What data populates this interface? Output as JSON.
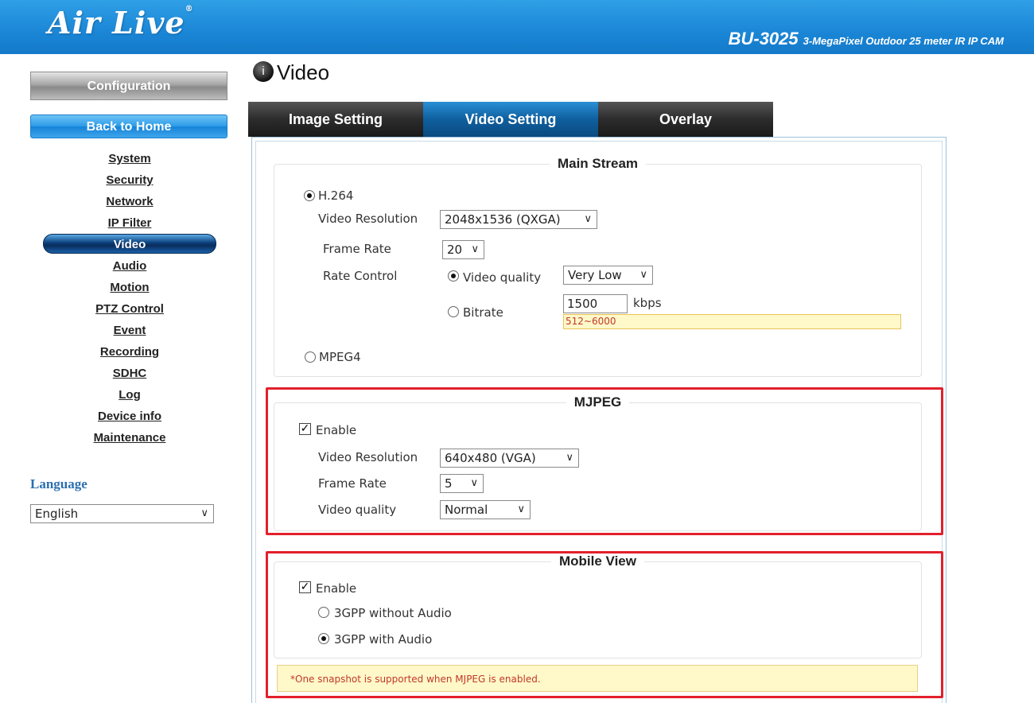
{
  "header": {
    "logo": "Air Live",
    "logo_mark": "®",
    "model_code": "BU-3025",
    "model_desc": "3-MegaPixel Outdoor 25 meter IR IP CAM"
  },
  "sidebar": {
    "configuration_label": "Configuration",
    "back_home_label": "Back to Home",
    "items": [
      "System",
      "Security",
      "Network",
      "IP Filter",
      "Video",
      "Audio",
      "Motion",
      "PTZ Control",
      "Event",
      "Recording",
      "SDHC",
      "Log",
      "Device info",
      "Maintenance"
    ],
    "active_item": "Video",
    "language_label": "Language",
    "language_value": "English"
  },
  "page": {
    "title_icon": "info-icon",
    "title": "Video"
  },
  "tabs": [
    "Image Setting",
    "Video Setting",
    "Overlay"
  ],
  "active_tab": "Video Setting",
  "main_stream": {
    "legend": "Main Stream",
    "h264_label": "H.264",
    "h264_selected": true,
    "resolution_label": "Video Resolution",
    "resolution_value": "2048x1536 (QXGA)",
    "frame_rate_label": "Frame Rate",
    "frame_rate_value": "20",
    "rate_control_label": "Rate Control",
    "video_quality_radio_label": "Video quality",
    "video_quality_value": "Very Low",
    "bitrate_label": "Bitrate",
    "bitrate_value": "1500",
    "bitrate_unit": "kbps",
    "bitrate_hint": "512~6000",
    "mpeg4_label": "MPEG4"
  },
  "mjpeg": {
    "legend": "MJPEG",
    "enable_label": "Enable",
    "resolution_label": "Video Resolution",
    "resolution_value": "640x480 (VGA)",
    "frame_rate_label": "Frame Rate",
    "frame_rate_value": "5",
    "quality_label": "Video quality",
    "quality_value": "Normal"
  },
  "mobile_view": {
    "legend": "Mobile View",
    "enable_label": "Enable",
    "option_no_audio": "3GPP without Audio",
    "option_audio": "3GPP with Audio"
  },
  "note": "*One snapshot is supported when MJPEG is enabled.",
  "colors": {
    "header_blue": "#1b86d6",
    "highlight_red": "#e2202c",
    "hint_bg": "#fff8c8",
    "hint_text": "#c0392b"
  }
}
